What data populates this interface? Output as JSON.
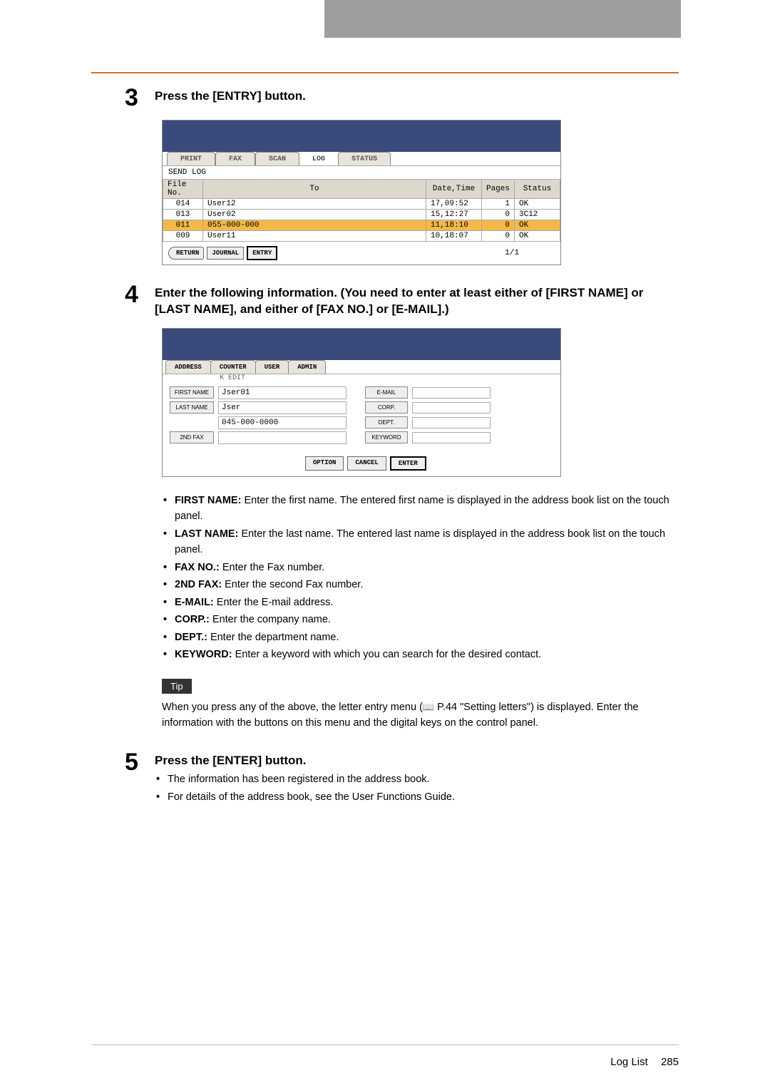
{
  "step3": {
    "number": "3",
    "title": "Press the [ENTRY] button.",
    "tabs": {
      "print": "PRINT",
      "fax": "FAX",
      "scan": "SCAN",
      "log": "LOG",
      "status": "STATUS"
    },
    "subtitle": "SEND LOG",
    "columns": {
      "fileno": "File No.",
      "to": "To",
      "datetime": "Date,Time",
      "pages": "Pages",
      "status": "Status"
    },
    "rows": [
      {
        "fileno": "014",
        "to": "User12",
        "datetime": "17,09:52",
        "pages": "1",
        "status": "OK"
      },
      {
        "fileno": "013",
        "to": "User02",
        "datetime": "15,12:27",
        "pages": "0",
        "status": "3C12"
      },
      {
        "fileno": "011",
        "to": "055-000-000",
        "datetime": "11,18:10",
        "pages": "0",
        "status": "OK"
      },
      {
        "fileno": "009",
        "to": "User11",
        "datetime": "10,18:07",
        "pages": "0",
        "status": "OK"
      }
    ],
    "buttons": {
      "return": "RETURN",
      "journal": "JOURNAL",
      "entry": "ENTRY"
    },
    "page": "1/1"
  },
  "step4": {
    "number": "4",
    "title": "Enter the following information. (You need to enter at least either of [FIRST NAME] or [LAST NAME], and either of [FAX NO.] or [E-MAIL].)",
    "tabs": {
      "address": "ADDRESS",
      "counter": "COUNTER",
      "user": "USER",
      "admin": "ADMIN"
    },
    "subtitle": "K EDIT",
    "fields": {
      "firstname_label": "FIRST NAME",
      "firstname_value": "Jser01",
      "lastname_label": "LAST NAME",
      "lastname_value": "Jser",
      "faxno_value": "045-000-0000",
      "secondfax_label": "2ND FAX",
      "email_label": "E-MAIL",
      "corp_label": "CORP.",
      "dept_label": "DEPT.",
      "keyword_label": "KEYWORD"
    },
    "buttons": {
      "option": "OPTION",
      "cancel": "CANCEL",
      "enter": "ENTER"
    },
    "bullets": {
      "firstname_b": "FIRST NAME:",
      "firstname_t": " Enter the first name. The entered first name is displayed in the address book list on the touch panel.",
      "lastname_b": "LAST NAME:",
      "lastname_t": " Enter the last name. The entered last name is displayed in the address book list on the touch panel.",
      "faxno_b": "FAX NO.:",
      "faxno_t": " Enter the Fax number.",
      "secondfax_b": "2ND FAX:",
      "secondfax_t": " Enter the second Fax number.",
      "email_b": "E-MAIL:",
      "email_t": " Enter the E-mail address.",
      "corp_b": "CORP.:",
      "corp_t": " Enter the company name.",
      "dept_b": "DEPT.:",
      "dept_t": " Enter the department name.",
      "keyword_b": "KEYWORD:",
      "keyword_t": " Enter a keyword with which you can search for the desired contact."
    },
    "tip": {
      "label": "Tip",
      "text_a": "When you press any of the above, the letter entry menu (",
      "ref": " P.44 \"Setting letters\") is displayed. Enter the information with the buttons on this menu and the digital keys on the control panel."
    }
  },
  "step5": {
    "number": "5",
    "title": "Press the [ENTER] button.",
    "bullets": {
      "b1": "The information has been registered in the address book.",
      "b2": "For details of the address book, see the User Functions Guide."
    }
  },
  "footer": {
    "section": "Log List",
    "page": "285"
  }
}
